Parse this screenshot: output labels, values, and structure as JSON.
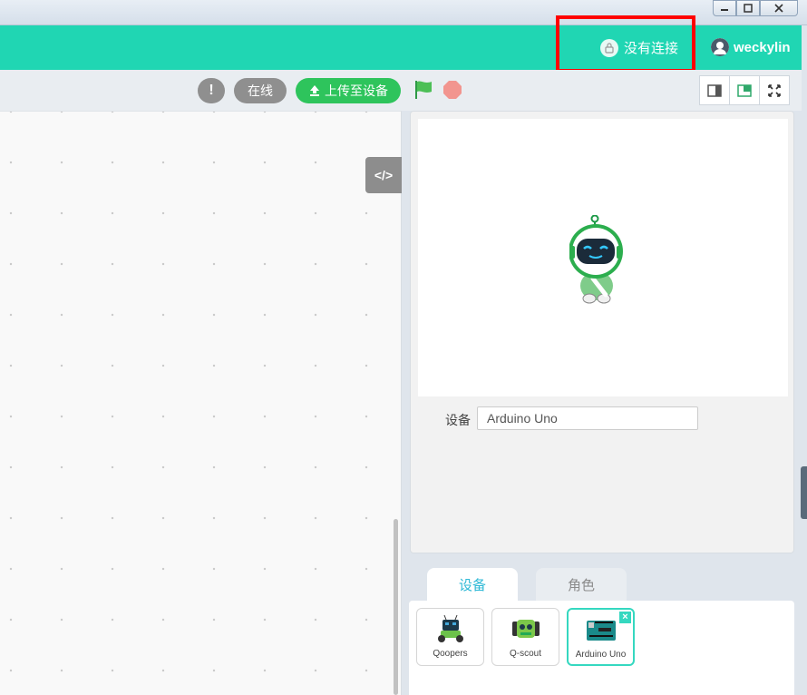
{
  "topbar": {
    "connection_status": "没有连接",
    "username": "weckylin",
    "accent": "#20d6b3"
  },
  "toolbar": {
    "warn_label": "!",
    "online_label": "在线",
    "upload_label": "上传至设备"
  },
  "code_toggle_label": "</>",
  "stage": {
    "device_label": "设备",
    "device_value": "Arduino Uno"
  },
  "tabs": [
    {
      "label": "设备",
      "active": true
    },
    {
      "label": "角色",
      "active": false
    }
  ],
  "devices": [
    {
      "name": "Qoopers",
      "icon": "qoopers-robot-icon"
    },
    {
      "name": "Q-scout",
      "icon": "qscout-robot-icon"
    },
    {
      "name": "Arduino Uno",
      "icon": "arduino-board-icon",
      "selected": true,
      "remove_label": "×"
    }
  ]
}
